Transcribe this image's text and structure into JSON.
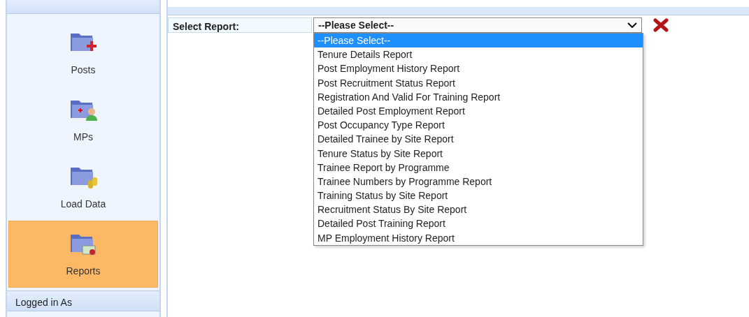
{
  "sidebar": {
    "items": [
      {
        "label": "Posts",
        "kind": "posts",
        "selected": false
      },
      {
        "label": "MPs",
        "kind": "mps",
        "selected": false
      },
      {
        "label": "Load Data",
        "kind": "load",
        "selected": false
      },
      {
        "label": "Reports",
        "kind": "reports",
        "selected": true
      }
    ],
    "footer": "Logged in As"
  },
  "report_form": {
    "label": "Select Report:",
    "value": "--Please Select--",
    "expanded": true,
    "options": [
      {
        "label": "--Please Select--",
        "selected": true
      },
      {
        "label": "Tenure Details Report",
        "selected": false
      },
      {
        "label": "Post Employment History Report",
        "selected": false
      },
      {
        "label": "Post Recruitment Status Report",
        "selected": false
      },
      {
        "label": "Registration And Valid For Training Report",
        "selected": false
      },
      {
        "label": "Detailed Post Employment Report",
        "selected": false
      },
      {
        "label": "Post Occupancy Type Report",
        "selected": false
      },
      {
        "label": "Detailed Trainee by Site Report",
        "selected": false
      },
      {
        "label": "Tenure Status by Site Report",
        "selected": false
      },
      {
        "label": "Trainee Report by Programme",
        "selected": false
      },
      {
        "label": "Trainee Numbers by Programme Report",
        "selected": false
      },
      {
        "label": "Training Status by Site Report",
        "selected": false
      },
      {
        "label": "Recruitment Status By Site Report",
        "selected": false
      },
      {
        "label": "Detailed Post Training Report",
        "selected": false
      },
      {
        "label": "MP Employment History Report",
        "selected": false
      }
    ]
  }
}
